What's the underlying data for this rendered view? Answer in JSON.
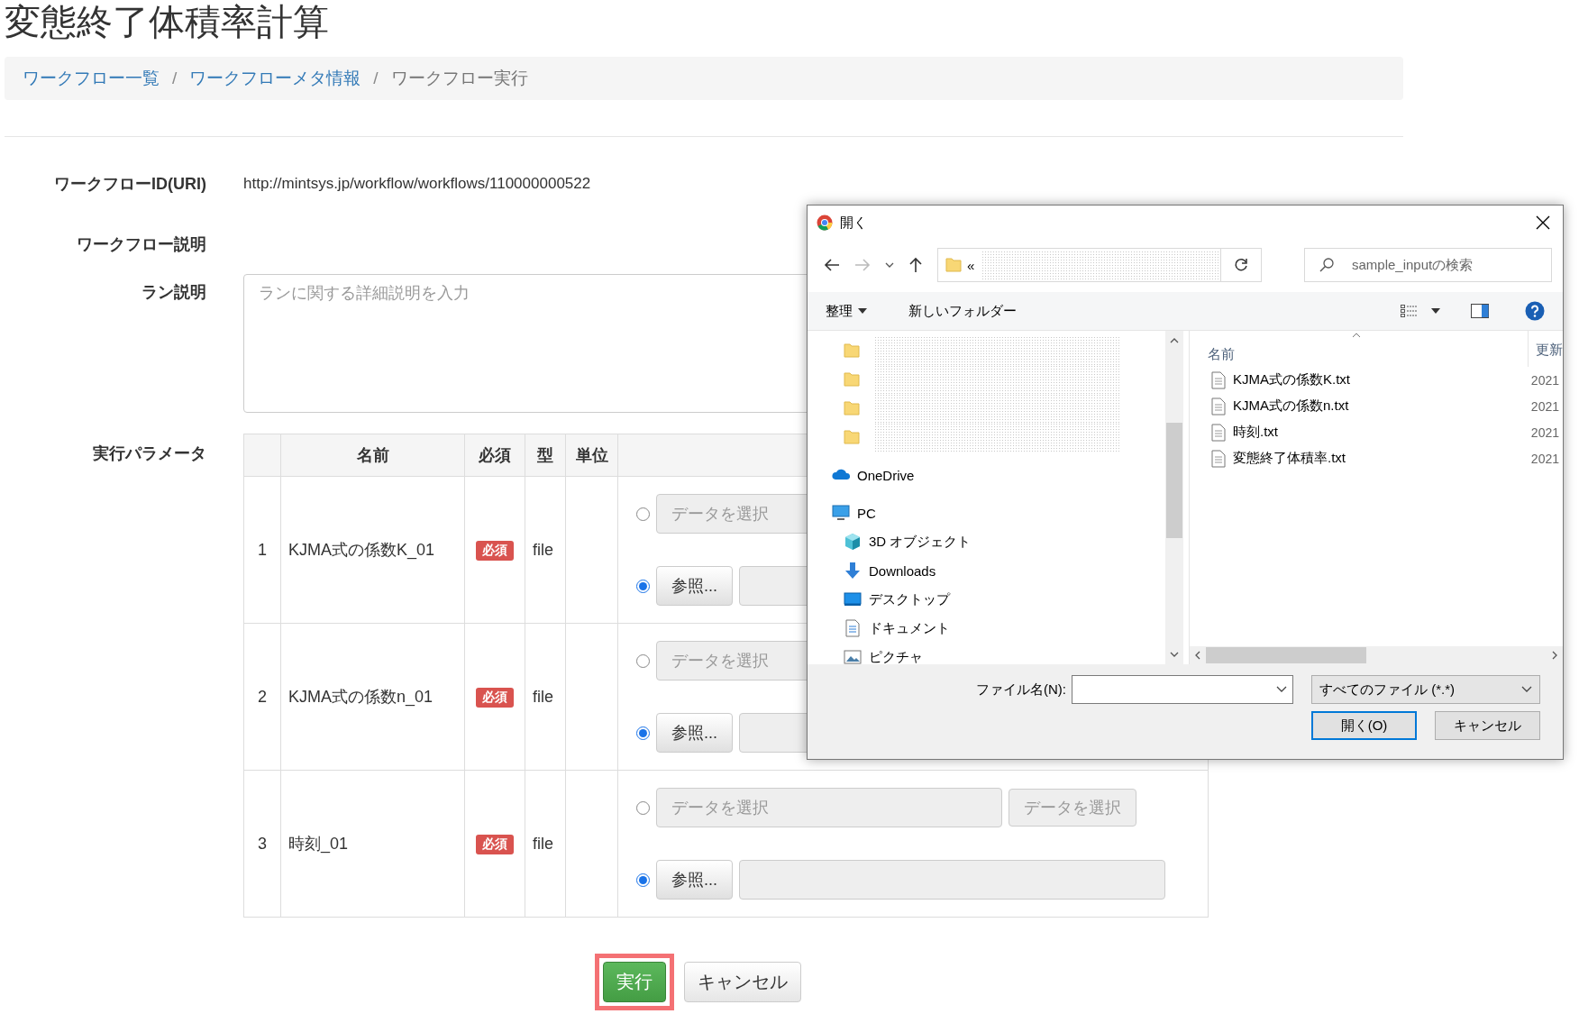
{
  "page_title": "変態終了体積率計算",
  "breadcrumb": [
    {
      "label": "ワークフロー一覧",
      "link": true
    },
    {
      "label": "ワークフローメタ情報",
      "link": true,
      "separator": "/"
    },
    {
      "label": "ワークフロー実行",
      "link": false,
      "separator": "/"
    }
  ],
  "form": {
    "workflow_id": {
      "label": "ワークフローID(URI)",
      "value": "http://mintsys.jp/workflow/workflows/110000000522"
    },
    "workflow_description": {
      "label": "ワークフロー説明"
    },
    "run_description": {
      "label": "ラン説明",
      "placeholder": "ランに関する詳細説明を入力"
    },
    "parameters": {
      "label": "実行パラメータ",
      "columns": [
        "名前",
        "必須",
        "型",
        "単位"
      ],
      "rows": [
        {
          "index": "1",
          "name": "KJMA式の係数K_01",
          "required_badge": "必須",
          "type": "file",
          "data_option": {
            "selected": false,
            "placeholder": "データを選択"
          },
          "browse_option": {
            "selected": true,
            "button": "参照..."
          }
        },
        {
          "index": "2",
          "name": "KJMA式の係数n_01",
          "required_badge": "必須",
          "type": "file",
          "data_option": {
            "selected": false,
            "placeholder": "データを選択"
          },
          "browse_option": {
            "selected": true,
            "button": "参照..."
          }
        },
        {
          "index": "3",
          "name": "時刻_01",
          "required_badge": "必須",
          "type": "file",
          "data_option": {
            "selected": false,
            "placeholder": "データを選択",
            "select_button": "データを選択"
          },
          "browse_option": {
            "selected": true,
            "button": "参照..."
          }
        }
      ]
    }
  },
  "actions": [
    {
      "label": "実行",
      "kind": "primary",
      "highlighted": true
    },
    {
      "label": "キャンセル",
      "kind": "default",
      "highlighted": false
    }
  ],
  "file_dialog": {
    "title": "開く",
    "address_prefix": "«",
    "search_placeholder": "sample_inputの検索",
    "organize": "整理",
    "new_folder": "新しいフォルダー",
    "tree": [
      {
        "kind": "redacted-folder"
      },
      {
        "kind": "redacted-folder"
      },
      {
        "kind": "redacted-folder"
      },
      {
        "kind": "redacted-folder"
      },
      {
        "kind": "onedrive",
        "label": "OneDrive"
      },
      {
        "kind": "pc",
        "label": "PC",
        "children": [
          {
            "kind": "cube",
            "label": "3D オブジェクト"
          },
          {
            "kind": "downloads",
            "label": "Downloads"
          },
          {
            "kind": "desktop",
            "label": "デスクトップ"
          },
          {
            "kind": "documents",
            "label": "ドキュメント"
          },
          {
            "kind": "pictures",
            "label": "ピクチャ"
          }
        ]
      }
    ],
    "columns": [
      "名前",
      "更新"
    ],
    "files": [
      {
        "name": "KJMA式の係数K.txt",
        "modified": "2021"
      },
      {
        "name": "KJMA式の係数n.txt",
        "modified": "2021"
      },
      {
        "name": "時刻.txt",
        "modified": "2021"
      },
      {
        "name": "変態終了体積率.txt",
        "modified": "2021"
      }
    ],
    "filename_label": "ファイル名(N):",
    "filter": "すべてのファイル (*.*)",
    "open_button": "開く(O)",
    "cancel_button": "キャンセル"
  }
}
